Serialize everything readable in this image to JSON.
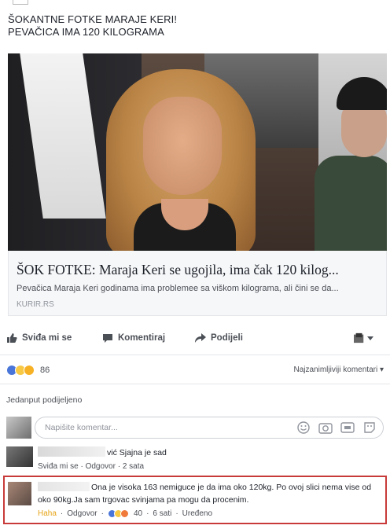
{
  "post": {
    "text_line1": "ŠOKANTNE FOTKE MARAJE KERI!",
    "text_line2": "PEVAČICA IMA 120 KILOGRAMA"
  },
  "link": {
    "title": "ŠOK FOTKE: Maraja Keri se ugojila, ima čak 120 kilog...",
    "description": "Pevačica Maraja Keri godinama ima problemee sa viškom kilograma, ali čini se da...",
    "domain": "KURIR.RS"
  },
  "actions": {
    "like": "Sviđa mi se",
    "comment": "Komentiraj",
    "share": "Podijeli"
  },
  "reactions": {
    "icons": [
      "like",
      "haha",
      "sad"
    ],
    "count": "86",
    "sort": "Najzanimljiviji komentari"
  },
  "shared_label": "Jedanput podijeljeno",
  "composer": {
    "placeholder": "Napišite komentar..."
  },
  "comments": [
    {
      "text": "vić Sjajna je sad",
      "like": "Sviđa mi se",
      "reply": "Odgovor",
      "time": "2 sata"
    },
    {
      "text": "Ona je visoka 163 nemiguce je da ima oko 120kg. Po ovoj slici nema vise od oko 90kg.Ja sam trgovac svinjama pa mogu da procenim.",
      "reaction_label": "Haha",
      "reply": "Odgovor",
      "reaction_count": "40",
      "time": "6 sati",
      "edited": "Uređeno"
    }
  ],
  "colors": {
    "highlight_border": "#c83a3a",
    "like_blue": "#4a76d9",
    "haha_yellow": "#f7c945"
  }
}
